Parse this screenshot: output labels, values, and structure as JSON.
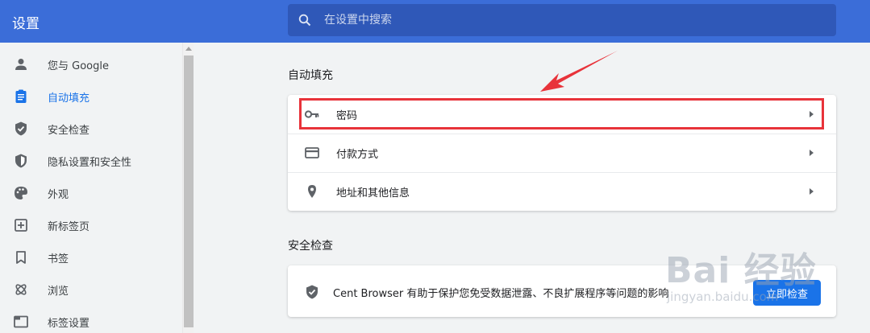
{
  "app": {
    "title": "设置"
  },
  "search": {
    "placeholder": "在设置中搜索",
    "icon": "search-icon"
  },
  "sidebar": {
    "items": [
      {
        "label": "您与 Google",
        "icon": "person-icon",
        "active": false
      },
      {
        "label": "自动填充",
        "icon": "clipboard-icon",
        "active": true
      },
      {
        "label": "安全检查",
        "icon": "shield-check-icon",
        "active": false
      },
      {
        "label": "隐私设置和安全性",
        "icon": "shield-half-icon",
        "active": false
      },
      {
        "label": "外观",
        "icon": "palette-icon",
        "active": false
      },
      {
        "label": "新标签页",
        "icon": "new-tab-icon",
        "active": false
      },
      {
        "label": "书签",
        "icon": "bookmark-icon",
        "active": false
      },
      {
        "label": "浏览",
        "icon": "browse-icon",
        "active": false
      },
      {
        "label": "标签设置",
        "icon": "tab-icon",
        "active": false
      }
    ]
  },
  "autofill": {
    "title": "自动填充",
    "rows": [
      {
        "label": "密码",
        "icon": "key-icon"
      },
      {
        "label": "付款方式",
        "icon": "credit-card-icon"
      },
      {
        "label": "地址和其他信息",
        "icon": "location-pin-icon"
      }
    ]
  },
  "safety": {
    "title": "安全检查",
    "description": "Cent Browser 有助于保护您免受数据泄露、不良扩展程序等问题的影响",
    "button_label": "立即检查"
  },
  "watermark": {
    "brand": "Bai 经验",
    "url": "jingyan.baidu.com"
  },
  "colors": {
    "topbar": "#3b6dd8",
    "search_bg": "#2f58b8",
    "accent": "#1a73e8",
    "highlight": "#e8333a"
  }
}
